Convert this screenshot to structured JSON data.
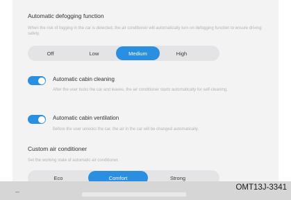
{
  "defogging": {
    "title": "Automatic defogging function",
    "description": "When the risk of fogging in the car is detected, the air conditioner will automatically turn on defogging function to ensure driving safety.",
    "options": [
      "Off",
      "Low",
      "Medium",
      "High"
    ],
    "selected": "Medium"
  },
  "cabin_cleaning": {
    "label": "Automatic cabin cleaning",
    "description": "After the user locks the car and leaves, the air conditioner starts automatically for self-cleaning.",
    "enabled": true
  },
  "cabin_ventilation": {
    "label": "Automatic cabin ventilation",
    "description": "Before the user unlocks the car, the air in the car will be changed automatically.",
    "enabled": true
  },
  "custom_ac": {
    "title": "Custom air conditioner",
    "description": "Set the working state of automatic air conditioner.",
    "options": [
      "Eco",
      "Comfort",
      "Strong"
    ],
    "selected": "Comfort"
  },
  "figure_code": "OMT13J-3341",
  "colors": {
    "accent": "#2b8fe1",
    "panel": "#f3f3f4",
    "track": "#e4e4e6"
  }
}
